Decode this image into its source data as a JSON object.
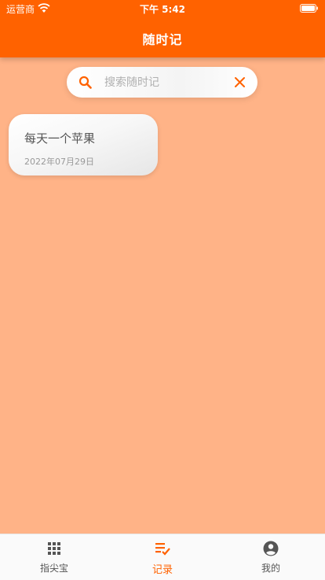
{
  "status_bar": {
    "carrier": "运营商",
    "time": "下午 5:42"
  },
  "header": {
    "title": "随时记"
  },
  "search": {
    "placeholder": "搜索随时记",
    "value": ""
  },
  "notes": [
    {
      "title": "每天一个苹果",
      "date": "2022年07月29日"
    }
  ],
  "tabbar": {
    "items": [
      {
        "label": "指尖宝",
        "icon": "apps-grid-icon"
      },
      {
        "label": "记录",
        "icon": "notes-check-icon"
      },
      {
        "label": "我的",
        "icon": "account-circle-icon"
      }
    ],
    "active_index": 1
  },
  "colors": {
    "accent": "#FF6200",
    "background": "#FFB387",
    "tab_inactive": "#555555"
  }
}
